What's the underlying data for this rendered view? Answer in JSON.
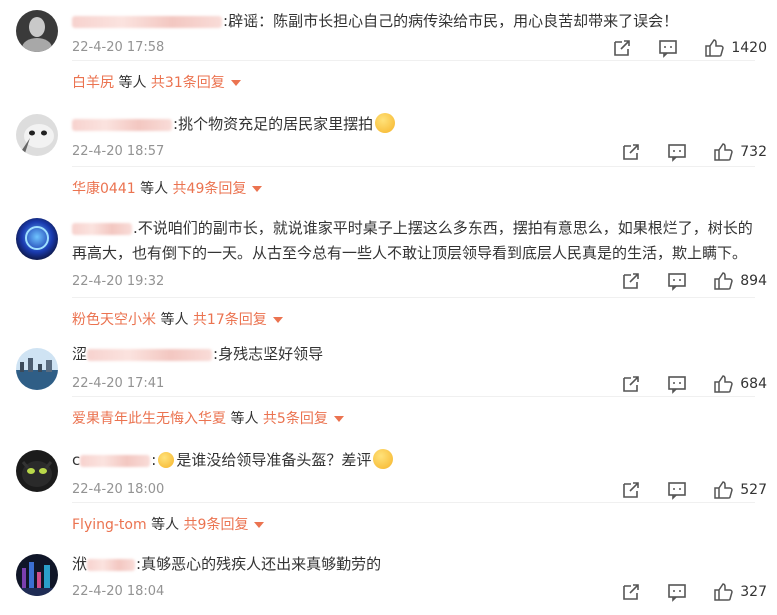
{
  "comments": [
    {
      "name_visible": ":",
      "text": "辟谣：陈副市长担心自己的病传染给市民，用心良苦却带来了误会！",
      "time": "22-4-20 17:58",
      "likes": "1420",
      "reply_user": "白羊尻",
      "reply_mid": "等人",
      "reply_count": "共31条回复"
    },
    {
      "name_visible": ":",
      "text": "挑个物资充足的居民家里摆拍",
      "time": "22-4-20 18:57",
      "likes": "732",
      "reply_user": "华康0441",
      "reply_mid": "等人",
      "reply_count": "共49条回复"
    },
    {
      "name_visible": ".",
      "text": "不说咱们的副市长，就说谁家平时桌子上摆这么多东西，摆拍有意思么，如果根烂了，树长的再高大，也有倒下的一天。从古至今总有一些人不敢让顶层领导看到底层人民真是的生活，欺上瞒下。",
      "time": "22-4-20 19:32",
      "likes": "894",
      "reply_user": "粉色天空小米",
      "reply_mid": "等人",
      "reply_count": "共17条回复"
    },
    {
      "name_prefix": "涩",
      "name_visible": ":",
      "text": "身残志坚好领导",
      "time": "22-4-20 17:41",
      "likes": "684",
      "reply_user": "爱果青年此生无悔入华夏",
      "reply_mid": "等人",
      "reply_count": "共5条回复"
    },
    {
      "name_prefix": "c",
      "name_visible": ":",
      "text": "是谁没给领导准备头盔？差评",
      "time": "22-4-20 18:00",
      "likes": "527",
      "reply_user": "Flying-tom",
      "reply_mid": "等人",
      "reply_count": "共9条回复"
    },
    {
      "name_prefix": "洑",
      "name_visible": ":",
      "text": "真够恶心的残疾人还出来真够勤劳的",
      "time": "22-4-20 18:04",
      "likes": "327"
    }
  ]
}
